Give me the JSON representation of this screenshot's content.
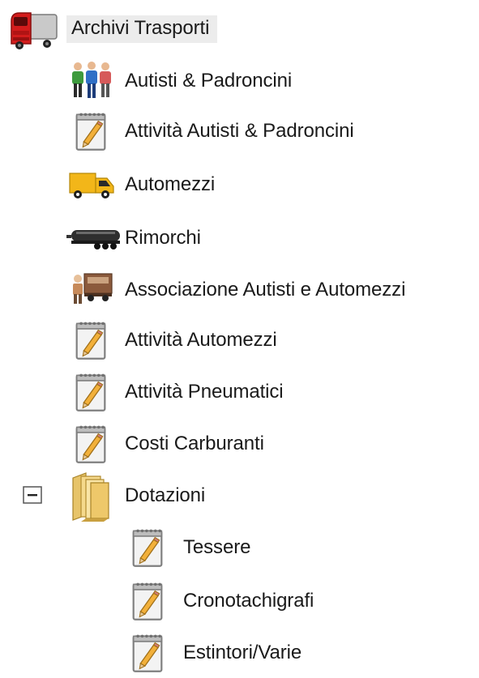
{
  "tree": {
    "root": {
      "label": "Archivi Trasporti",
      "icon": "truck-red-icon"
    },
    "items": [
      {
        "label": "Autisti & Padroncini",
        "icon": "people-icon"
      },
      {
        "label": "Attività Autisti & Padroncini",
        "icon": "notepad-pencil-icon"
      },
      {
        "label": "Automezzi",
        "icon": "delivery-truck-icon"
      },
      {
        "label": "Rimorchi",
        "icon": "trailer-icon"
      },
      {
        "label": "Associazione Autisti e Automezzi",
        "icon": "driver-truck-icon"
      },
      {
        "label": "Attività Automezzi",
        "icon": "notepad-pencil-icon"
      },
      {
        "label": "Attività Pneumatici",
        "icon": "notepad-pencil-icon"
      },
      {
        "label": "Costi Carburanti",
        "icon": "notepad-pencil-icon"
      }
    ],
    "folder": {
      "label": "Dotazioni",
      "icon": "folder-icon",
      "expander": "minus",
      "children": [
        {
          "label": "Tessere",
          "icon": "notepad-pencil-icon"
        },
        {
          "label": "Cronotachigrafi",
          "icon": "notepad-pencil-icon"
        },
        {
          "label": "Estintori/Varie",
          "icon": "notepad-pencil-icon"
        }
      ]
    }
  }
}
